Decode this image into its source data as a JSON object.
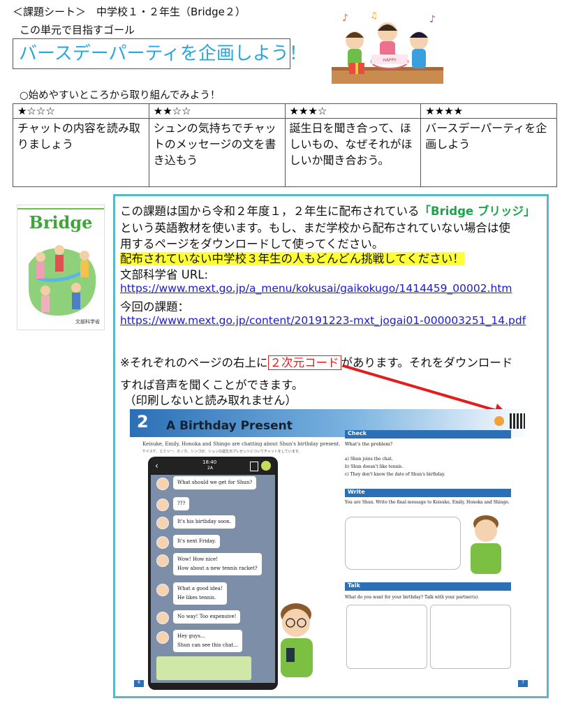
{
  "header": {
    "title": "＜課題シート＞　中学校１・２年生（Bridge２）",
    "goal_label": "この単元で目指すゴール",
    "goal": "バースデーパーティを企画しよう！"
  },
  "steps": {
    "note": "○始めやすいところから取り組んでみよう！",
    "columns": [
      {
        "stars": "★☆☆☆",
        "text": "チャットの内容を読み取りましょう"
      },
      {
        "stars": "★★☆☆",
        "text": "シュンの気持ちでチャットのメッセージの文を書き込もう"
      },
      {
        "stars": "★★★☆",
        "text": "誕生日を聞き合って、ほしいもの、なぜそれがほしいか聞き合おう。"
      },
      {
        "stars": "★★★★",
        "text": "バースデーパーティを企画しよう"
      }
    ]
  },
  "cover": {
    "title": "Bridge",
    "publisher": "文部科学省"
  },
  "panel": {
    "line1_a": "この課題は国から令和２年度１，２年生に配布されている",
    "line1_b": "「Bridge ブリッジ」",
    "line2": "という英語教材を使います。もし、まだ学校から配布されていない場合は使",
    "line3": "用するページをダウンロードして使ってください。",
    "highlight": "配布されていない中学校３年生の人もどんどん挑戦してください！",
    "url_label": "文部科学省 URL:",
    "url1": "https://www.mext.go.jp/a_menu/kokusai/gaikokugo/1414459_00002.htm",
    "task_label": "今回の課題：",
    "url2": "https://www.mext.go.jp/content/20191223-mxt_jogai01-000003251_14.pdf",
    "qr_a": "※それぞれのページの右上に",
    "qr_box": "２次元コード",
    "qr_b": "があります。それをダウンロード",
    "qr_c": "すれば音声を聞くことができます。",
    "qr_d": "（印刷しないと読み取れません）"
  },
  "textbook": {
    "num": "2",
    "title": "A Birthday Present",
    "intro": "Keisuke, Emily, Honoka and Shingo are chatting about Shun's birthday present.",
    "intro_jp": "ケイスケ、エミリー、ホノカ、シンゴが、シュンの誕生日プレゼントについてチャットをしています。",
    "phone_time": "18:40",
    "phone_room": "2A",
    "chats": [
      "What should we get for Shun?",
      "???",
      "It's his birthday soon.",
      "It's next Friday.",
      "Wow! How nice!",
      "How about a new tennis racket?",
      "What a good idea!",
      "He likes tennis.",
      "No way! Too expensive!",
      "Hey guys...",
      "Shun can see this chat..."
    ],
    "check_title": "Check",
    "check_q": "What's the problem?",
    "check_a": "a) Shun joins the chat.",
    "check_b": "b) Shun doesn't like tennis.",
    "check_c": "c) They don't know the date of Shun's birthday.",
    "write_title": "Write",
    "write_text": "You are Shun. Write the final message to Keisuke, Emily, Honoka and Shingo.",
    "talk_title": "Talk",
    "talk_text": "What do you want for your birthday? Talk with your partner(s).",
    "page_left": "6",
    "page_right": "7"
  }
}
